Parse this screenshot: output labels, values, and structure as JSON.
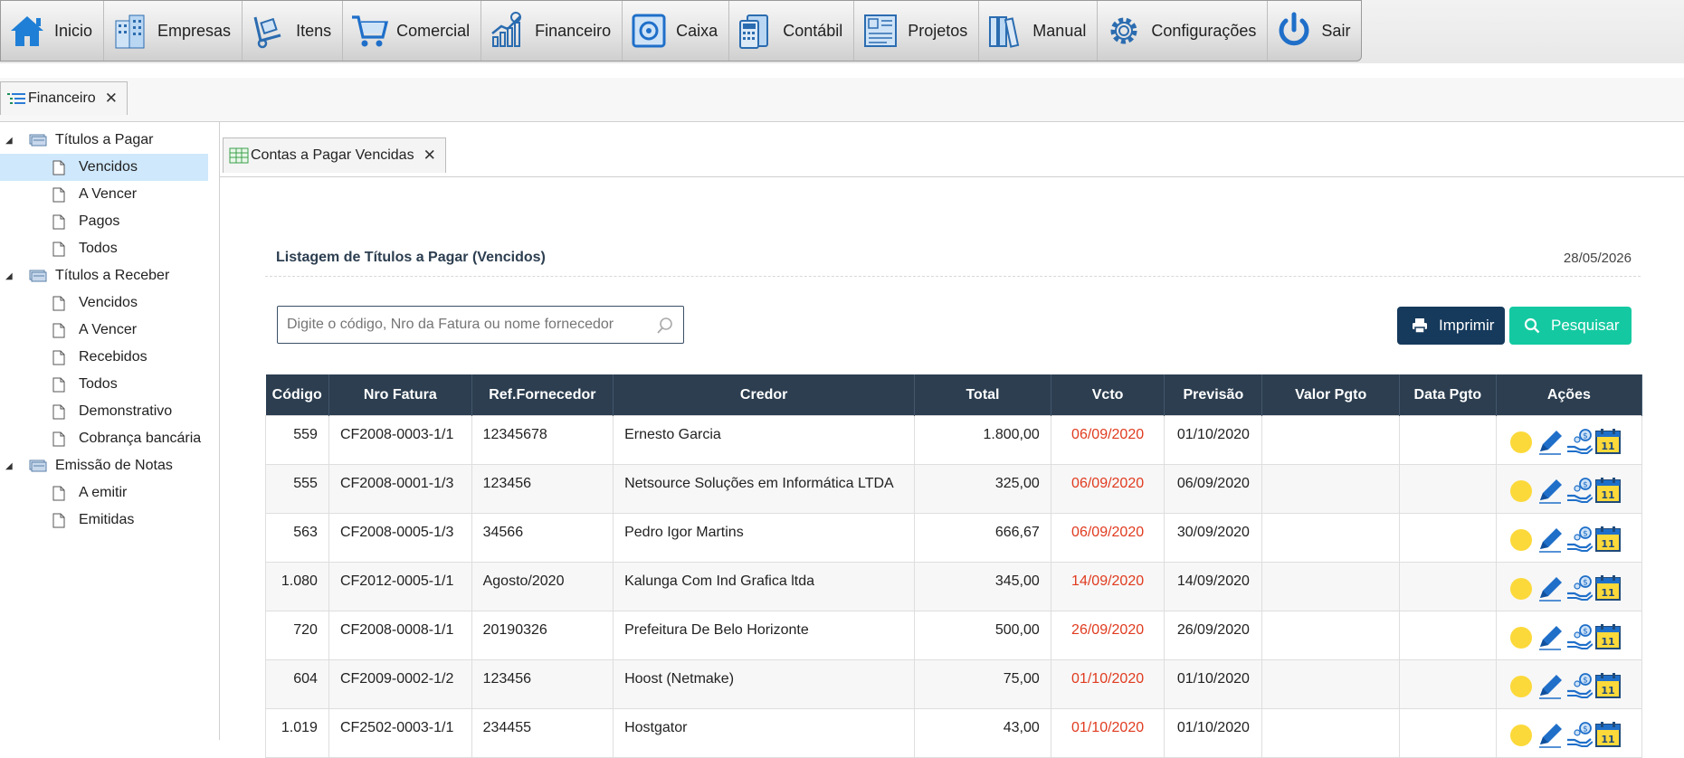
{
  "menu": [
    {
      "label": "Inicio",
      "icon": "home-icon"
    },
    {
      "label": "Empresas",
      "icon": "buildings-icon"
    },
    {
      "label": "Itens",
      "icon": "hand-truck-icon"
    },
    {
      "label": "Comercial",
      "icon": "shopping-cart-icon"
    },
    {
      "label": "Financeiro",
      "icon": "chart-growth-icon"
    },
    {
      "label": "Caixa",
      "icon": "safe-icon"
    },
    {
      "label": "Contábil",
      "icon": "calculator-icon"
    },
    {
      "label": "Projetos",
      "icon": "blueprint-icon"
    },
    {
      "label": "Manual",
      "icon": "books-icon"
    },
    {
      "label": "Configurações",
      "icon": "gear-icon"
    },
    {
      "label": "Sair",
      "icon": "power-icon"
    }
  ],
  "module_tab": {
    "label": "Financeiro",
    "close": "✕"
  },
  "sidebar": {
    "groups": [
      {
        "label": "Títulos a Pagar",
        "items": [
          "Vencidos",
          "A Vencer",
          "Pagos",
          "Todos"
        ]
      },
      {
        "label": "Títulos a Receber",
        "items": [
          "Vencidos",
          "A Vencer",
          "Recebidos",
          "Todos",
          "Demonstrativo",
          "Cobrança bancária"
        ]
      },
      {
        "label": "Emissão de Notas",
        "items": [
          "A emitir",
          "Emitidas"
        ]
      }
    ],
    "selected": "Títulos a Pagar / Vencidos"
  },
  "content_tab": {
    "label": "Contas a Pagar Vencidas",
    "close": "✕"
  },
  "panel": {
    "title": "Listagem de Títulos a Pagar (Vencidos)",
    "date": "28/05/2026"
  },
  "search": {
    "placeholder": "Digite o código, Nro da Fatura ou nome fornecedor",
    "value": ""
  },
  "buttons": {
    "print": "Imprimir",
    "search": "Pesquisar"
  },
  "colors": {
    "header_bg": "#2c3e50",
    "print_bg": "#163a5c",
    "search_bg": "#14c9a1",
    "overdue_text": "#e03b1f",
    "selected_bg": "#cfe8fb"
  },
  "table": {
    "columns": [
      "Código",
      "Nro Fatura",
      "Ref.Fornecedor",
      "Credor",
      "Total",
      "Vcto",
      "Previsão",
      "Valor Pgto",
      "Data Pgto",
      "Ações"
    ],
    "rows": [
      [
        "559",
        "CF2008-0003-1/1",
        "12345678",
        "Ernesto Garcia",
        "1.800,00",
        "06/09/2020",
        "01/10/2020",
        "",
        ""
      ],
      [
        "555",
        "CF2008-0001-1/3",
        "123456",
        "Netsource Soluções em Informática LTDA",
        "325,00",
        "06/09/2020",
        "06/09/2020",
        "",
        ""
      ],
      [
        "563",
        "CF2008-0005-1/3",
        "34566",
        "Pedro Igor Martins",
        "666,67",
        "06/09/2020",
        "30/09/2020",
        "",
        ""
      ],
      [
        "1.080",
        "CF2012-0005-1/1",
        "Agosto/2020",
        "Kalunga Com Ind Grafica ltda",
        "345,00",
        "14/09/2020",
        "14/09/2020",
        "",
        ""
      ],
      [
        "720",
        "CF2008-0008-1/1",
        "20190326",
        "Prefeitura De Belo Horizonte",
        "500,00",
        "26/09/2020",
        "26/09/2020",
        "",
        ""
      ],
      [
        "604",
        "CF2009-0002-1/2",
        "123456",
        "Hoost (Netmake)",
        "75,00",
        "01/10/2020",
        "01/10/2020",
        "",
        ""
      ],
      [
        "1.019",
        "CF2502-0003-1/1",
        "234455",
        "Hostgator",
        "43,00",
        "01/10/2020",
        "01/10/2020",
        "",
        ""
      ]
    ],
    "actions": [
      "status-dot-icon",
      "edit-pencil-icon",
      "payment-hand-icon",
      "calendar-icon"
    ],
    "calendar_day": "11"
  }
}
